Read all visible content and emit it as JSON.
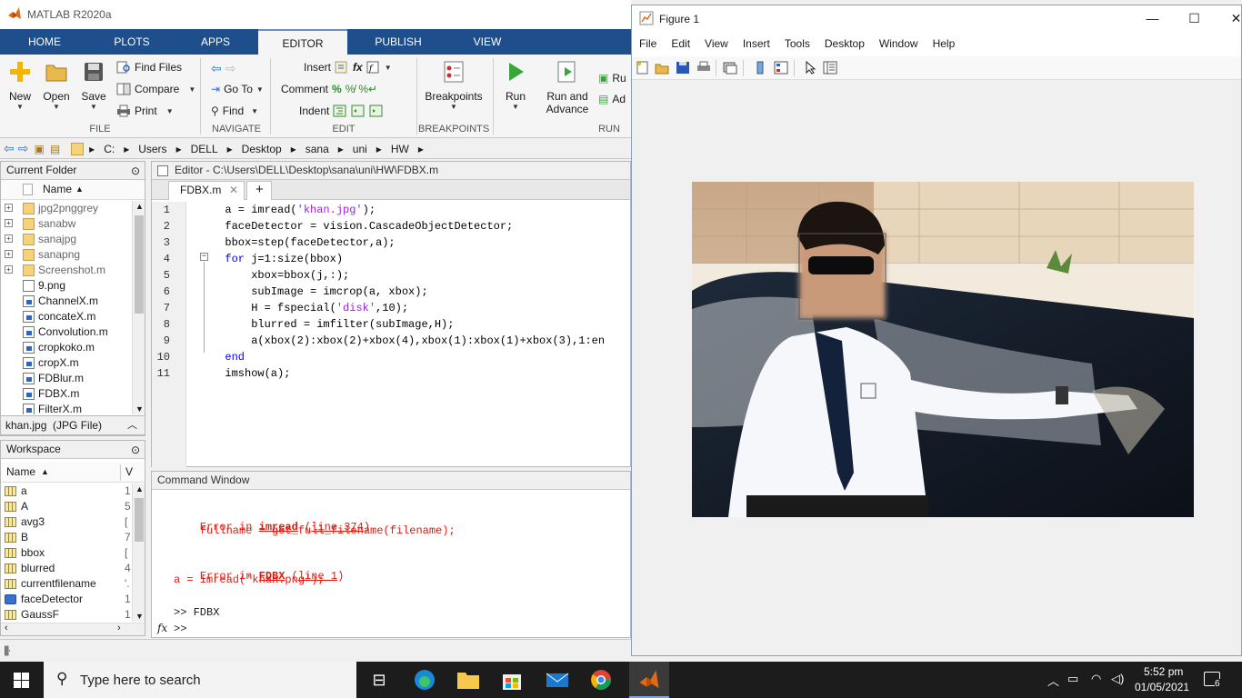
{
  "app": {
    "title": "MATLAB R2020a"
  },
  "tabs": [
    "HOME",
    "PLOTS",
    "APPS",
    "EDITOR",
    "PUBLISH",
    "VIEW"
  ],
  "ribbon": {
    "file": {
      "new": "New",
      "open": "Open",
      "save": "Save",
      "find_files": "Find Files",
      "compare": "Compare",
      "print": "Print",
      "group": "FILE"
    },
    "navigate": {
      "go_to": "Go To",
      "find": "Find",
      "group": "NAVIGATE"
    },
    "edit": {
      "insert": "Insert",
      "comment": "Comment",
      "indent": "Indent",
      "group": "EDIT"
    },
    "breakpoints": {
      "label": "Breakpoints",
      "group": "BREAKPOINTS"
    },
    "run": {
      "run": "Run",
      "run_advance_1": "Run and",
      "run_advance_2": "Advance",
      "run_section": "Ru",
      "advance": "Ad",
      "group": "RUN"
    }
  },
  "address": [
    "C:",
    "Users",
    "DELL",
    "Desktop",
    "sana",
    "uni",
    "HW"
  ],
  "current_folder": {
    "title": "Current Folder",
    "name_header": "Name",
    "items": [
      {
        "name": "jpg2pnggrey",
        "kind": "folder"
      },
      {
        "name": "sanabw",
        "kind": "folder"
      },
      {
        "name": "sanajpg",
        "kind": "folder"
      },
      {
        "name": "sanapng",
        "kind": "folder"
      },
      {
        "name": "Screenshot.m",
        "kind": "folder"
      },
      {
        "name": "9.png",
        "kind": "png"
      },
      {
        "name": "ChannelX.m",
        "kind": "m"
      },
      {
        "name": "concateX.m",
        "kind": "m"
      },
      {
        "name": "Convolution.m",
        "kind": "m"
      },
      {
        "name": "cropkoko.m",
        "kind": "m"
      },
      {
        "name": "cropX.m",
        "kind": "m"
      },
      {
        "name": "FDBlur.m",
        "kind": "m"
      },
      {
        "name": "FDBX.m",
        "kind": "m"
      },
      {
        "name": "FilterX.m",
        "kind": "m"
      }
    ],
    "detail": "khan.jpg  (JPG File)"
  },
  "workspace": {
    "title": "Workspace",
    "name_header": "Name",
    "value_header": "V",
    "items": [
      {
        "name": "a",
        "value": "1"
      },
      {
        "name": "A",
        "value": "5"
      },
      {
        "name": "avg3",
        "value": "["
      },
      {
        "name": "B",
        "value": "7"
      },
      {
        "name": "bbox",
        "value": "["
      },
      {
        "name": "blurred",
        "value": "4"
      },
      {
        "name": "currentfilename",
        "value": "'."
      },
      {
        "name": "faceDetector",
        "value": "1"
      },
      {
        "name": "GaussF",
        "value": "1"
      }
    ]
  },
  "editor": {
    "title": "Editor - C:\\Users\\DELL\\Desktop\\sana\\uni\\HW\\FDBX.m",
    "tab": "FDBX.m",
    "add_tab": "+",
    "lines": [
      "  a = imread('khan.jpg');",
      "  faceDetector = vision.CascadeObjectDetector;",
      "  bbox=step(faceDetector,a);",
      "  for j=1:size(bbox)",
      "      xbox=bbox(j,:);",
      "      subImage = imcrop(a, xbox);",
      "      H = fspecial('disk',10);",
      "      blurred = imfilter(subImage,H);",
      "      a(xbox(2):xbox(2)+xbox(4),xbox(1):xbox(1)+xbox(3),1:en",
      "  end",
      "  imshow(a);"
    ]
  },
  "command_window": {
    "title": "Command Window",
    "err1_prefix": "Error in ",
    "err1_func": "imread",
    "err1_line": "line 374",
    "err1_code": "    fullname = get_full_filename(filename);",
    "err2_prefix": "Error in ",
    "err2_func": "FDBX",
    "err2_line": "line 1",
    "err2_code": "a = imread('khan.png');",
    "prompt1": ">> FDBX",
    "prompt2": ">>",
    "fx": "fx"
  },
  "figure": {
    "title": "Figure 1",
    "menu": [
      "File",
      "Edit",
      "View",
      "Insert",
      "Tools",
      "Desktop",
      "Window",
      "Help"
    ]
  },
  "taskbar": {
    "search_placeholder": "Type here to search",
    "time": "5:52 pm",
    "date": "01/05/2021",
    "notifications": "6"
  },
  "colors": {
    "tab_bar": "#1f4e8c",
    "error_text": "#e0190f",
    "keyword": "#0000ff",
    "string": "#a020f0"
  }
}
